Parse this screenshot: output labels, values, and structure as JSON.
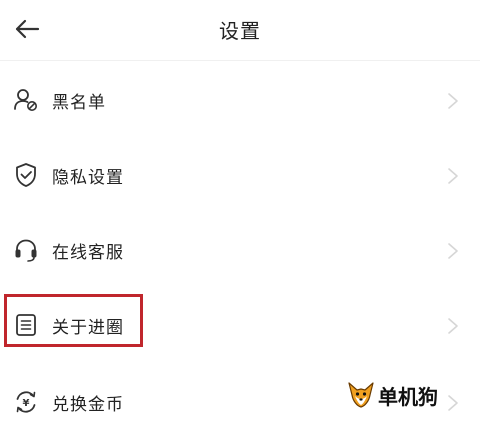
{
  "header": {
    "title": "设置",
    "back_icon": "arrow-left-icon"
  },
  "menu": {
    "items": [
      {
        "label": "黑名单",
        "icon": "user-blocked-icon"
      },
      {
        "label": "隐私设置",
        "icon": "shield-check-icon"
      },
      {
        "label": "在线客服",
        "icon": "headset-icon"
      },
      {
        "label": "关于进圈",
        "icon": "document-icon"
      },
      {
        "label": "兑换金币",
        "icon": "coin-exchange-icon"
      }
    ],
    "chevron_icon": "chevron-right-icon"
  },
  "annotation": {
    "highlight_color": "#c0262c"
  },
  "watermark": {
    "text": "单机狗"
  },
  "colors": {
    "icon_stroke": "#333333",
    "chevron": "#d6d6d6",
    "divider": "#f0f0f0"
  }
}
